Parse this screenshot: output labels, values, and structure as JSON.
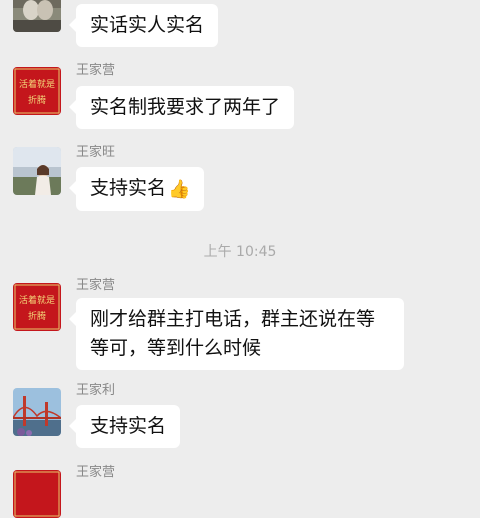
{
  "colors": {
    "background": "#ededed",
    "bubble": "#ffffff",
    "sender_name": "#888888",
    "timestamp": "#aaaaaa",
    "avatar_red": "#c4161c"
  },
  "messages": [
    {
      "sender": "",
      "text": "实话实人实名",
      "avatar": "photo-avatar-partial"
    },
    {
      "sender": "王家营",
      "text": "实名制我要求了两年了",
      "avatar": "red-calligraphy-avatar"
    },
    {
      "sender": "王家旺",
      "text": "支持实名",
      "emoji": "👍",
      "avatar": "portrait-photo-avatar"
    },
    {
      "sender": "王家营",
      "text": "刚才给群主打电话，群主还说在等等可，等到什么时候",
      "avatar": "red-calligraphy-avatar"
    },
    {
      "sender": "王家利",
      "text": "支持实名",
      "avatar": "golden-gate-bridge-avatar"
    },
    {
      "sender": "王家营",
      "text": "",
      "avatar": "red-calligraphy-avatar"
    }
  ],
  "timestamp": "上午 10:45",
  "avatar_calligraphy": {
    "line1": "活着就是",
    "line2": "折腾"
  }
}
